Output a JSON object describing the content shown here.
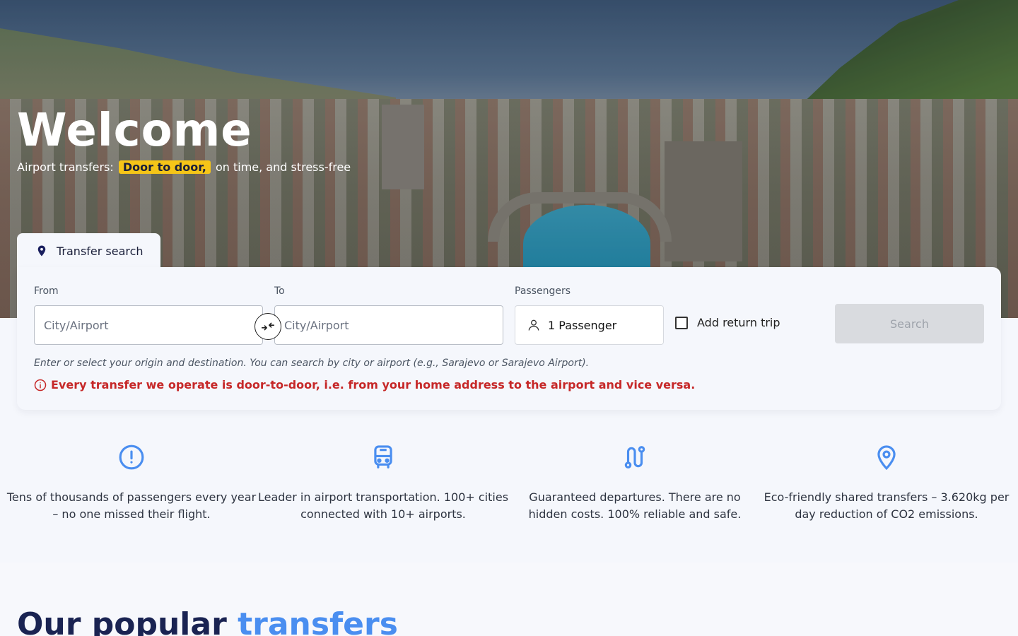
{
  "hero": {
    "title": "Welcome",
    "subtitle_prefix": "Airport transfers:",
    "subtitle_highlight": "Door to door,",
    "subtitle_suffix": "on time, and stress-free"
  },
  "search": {
    "tab_label": "Transfer search",
    "from_label": "From",
    "from_placeholder": "City/Airport",
    "to_label": "To",
    "to_placeholder": "City/Airport",
    "passengers_label": "Passengers",
    "passengers_value": "1 Passenger",
    "return_trip_label": "Add return trip",
    "return_trip_checked": false,
    "search_button": "Search",
    "hint": "Enter or select your origin and destination. You can search by city or airport (e.g., Sarajevo or Sarajevo Airport).",
    "warning": "Every transfer we operate is door-to-door, i.e. from your home address to the airport and vice versa."
  },
  "features": [
    {
      "icon": "exclamation-circle-icon",
      "text": "Tens of thousands of passengers every year – no one missed their flight."
    },
    {
      "icon": "bus-icon",
      "text": "Leader in airport transportation. 100+ cities connected with 10+ airports."
    },
    {
      "icon": "route-icon",
      "text": "Guaranteed departures. There are no hidden costs. 100% reliable and safe."
    },
    {
      "icon": "map-pin-icon",
      "text": "Eco-friendly shared transfers – 3.620kg per day reduction of CO2 emissions."
    }
  ],
  "popular": {
    "title_part1": "Our popular",
    "title_part2": "transfers"
  },
  "colors": {
    "accent": "#4a8ef0",
    "navy": "#1a2352",
    "highlight": "#f5c518",
    "warning": "#c62828"
  }
}
